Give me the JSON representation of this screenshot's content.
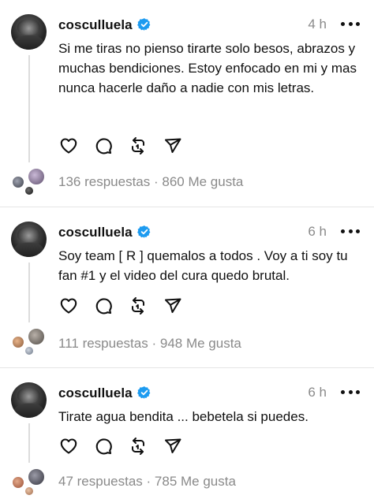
{
  "colors": {
    "verified_badge": "#1d9bf0",
    "secondary_text": "#8a8a8a",
    "divider": "#e5e5e5"
  },
  "icons": {
    "like": "heart-icon",
    "reply": "comment-icon",
    "repost": "repost-icon",
    "share": "send-icon",
    "more": "more-icon",
    "verified": "verified-badge-icon"
  },
  "posts": [
    {
      "username": "cosculluela",
      "time": "4 h",
      "text": "Si me tiras no pienso tirarte solo besos, abrazos y muchas bendiciones. Estoy enfocado en mi y mas nunca hacerle daño a nadie con mis letras.",
      "replies": "136 respuestas",
      "separator": "·",
      "likes": "860 Me gusta"
    },
    {
      "username": "cosculluela",
      "time": "6 h",
      "text": "Soy team [ R ] quemalos a todos . Voy a ti soy tu fan #1 y el video del cura quedo brutal.",
      "replies": "111 respuestas",
      "separator": "·",
      "likes": "948 Me gusta"
    },
    {
      "username": "cosculluela",
      "time": "6 h",
      "text": "Tirate agua bendita ... bebetela si puedes.",
      "replies": "47 respuestas",
      "separator": "·",
      "likes": "785 Me gusta"
    }
  ]
}
